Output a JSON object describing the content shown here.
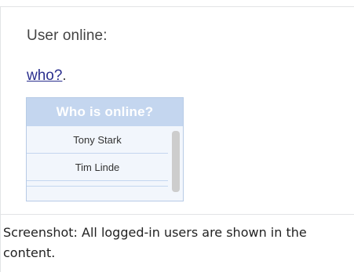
{
  "content": {
    "label": "User online:",
    "link_text": "who?",
    "link_suffix": "."
  },
  "widget": {
    "header": "Who is online?",
    "users": [
      "Tony Stark",
      "Tim Linde"
    ]
  },
  "caption": "Screenshot: All logged-in users are shown in the content."
}
